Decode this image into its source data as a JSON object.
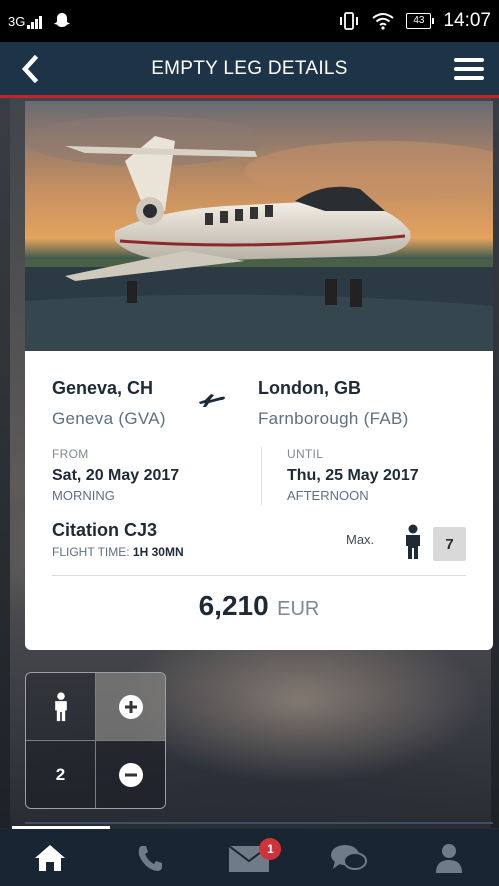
{
  "status_bar": {
    "network": "3G",
    "battery": "43",
    "time": "14:07"
  },
  "app_bar": {
    "title": "EMPTY LEG DETAILS"
  },
  "flight": {
    "from_city": "Geneva, CH",
    "from_airport": "Geneva (GVA)",
    "to_city": "London, GB",
    "to_airport": "Farnborough (FAB)",
    "from_label": "FROM",
    "from_date": "Sat, 20 May 2017",
    "from_daypart": "MORNING",
    "until_label": "UNTIL",
    "until_date": "Thu, 25 May 2017",
    "until_daypart": "AFTERNOON",
    "aircraft": "Citation CJ3",
    "flight_time_label": "FLIGHT TIME:",
    "flight_time_value": "1H 30MN",
    "max_label": "Max.",
    "max_passengers": "7",
    "price_value": "6,210",
    "price_currency": "EUR"
  },
  "stepper": {
    "count": "2"
  },
  "nav": {
    "items": [
      "home-icon",
      "phone-icon",
      "mail-icon",
      "chat-icon",
      "profile-icon"
    ],
    "mail_badge": "1",
    "active": "home-icon"
  },
  "colors": {
    "app_bar": "#1d3448",
    "accent": "#c0252c",
    "nav": "#182633",
    "badge": "#d0323a"
  }
}
